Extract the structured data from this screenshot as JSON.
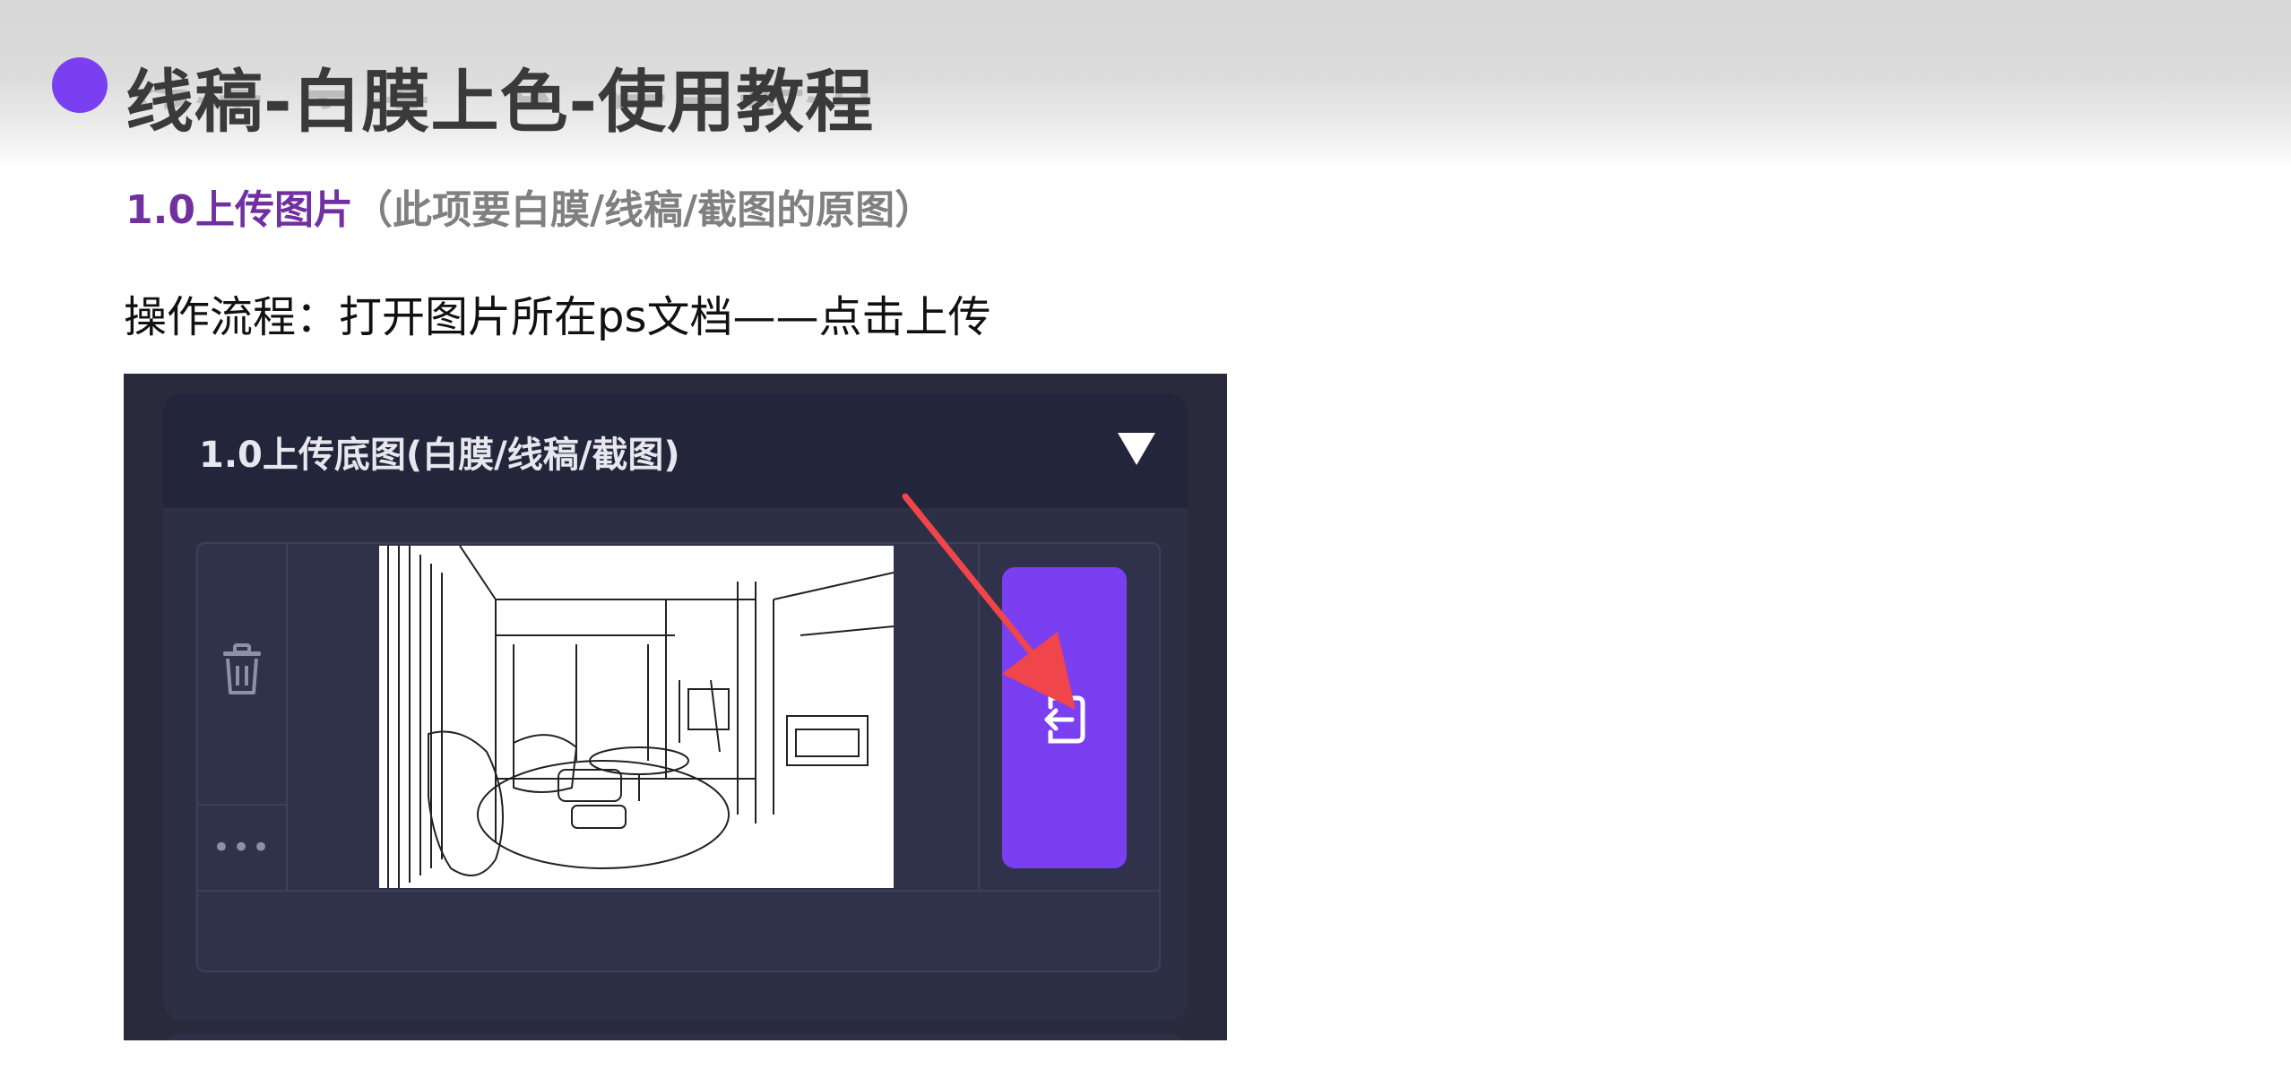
{
  "slide": {
    "title": "线稿-白膜上色-使用教程",
    "section_heading": "1.0上传图片",
    "section_note": "（此项要白膜/线稿/截图的原图）",
    "steps": "操作流程：打开图片所在ps文档——点击上传"
  },
  "panel": {
    "header_label": "1.0上传底图(白膜/线稿/截图)",
    "collapse_icon": "triangle-down-icon",
    "delete_icon": "trash-icon",
    "more_label": "•••",
    "upload_icon": "import-icon",
    "preview_content": "line-drawing-of-living-room"
  },
  "colors": {
    "accent": "#7a3ff0",
    "heading_purple": "#7030a0",
    "note_gray": "#808080",
    "title_gray": "#3a3a3a",
    "panel_bg": "#292b3c",
    "annotation_arrow": "#f0454b"
  }
}
